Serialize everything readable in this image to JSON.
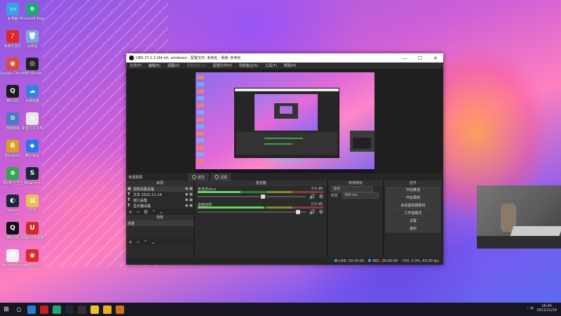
{
  "desktop": {
    "icons": [
      {
        "label": "此电脑",
        "color": "#3aa0e8",
        "glyph": "▭"
      },
      {
        "label": "Microsoft Edge",
        "color": "#1fa67a",
        "glyph": "e"
      },
      {
        "label": "网易云音乐",
        "color": "#e02828",
        "glyph": "♪"
      },
      {
        "label": "回收站",
        "color": "#7aa7d8",
        "glyph": "🗑"
      },
      {
        "label": "Google Chrome",
        "color": "#dd4b3e",
        "glyph": "◉"
      },
      {
        "label": "OBS Studio",
        "color": "#222222",
        "glyph": "◎"
      },
      {
        "label": "腾讯QQ",
        "color": "#1a1a1a",
        "glyph": "Q"
      },
      {
        "label": "百度网盘",
        "color": "#2f84e8",
        "glyph": "☁"
      },
      {
        "label": "控制面板",
        "color": "#4a7ac0",
        "glyph": "⚙"
      },
      {
        "label": "新建文本文档",
        "color": "#e8e8e8",
        "glyph": "≡"
      },
      {
        "label": "Bandizip",
        "color": "#d8a020",
        "glyph": "B"
      },
      {
        "label": "腾讯会议",
        "color": "#2878e8",
        "glyph": "◆"
      },
      {
        "label": "360安全卫士",
        "color": "#2ea84a",
        "glyph": "⊕"
      },
      {
        "label": "Steam++",
        "color": "#1b2838",
        "glyph": "S"
      },
      {
        "label": "Steam",
        "color": "#1b2838",
        "glyph": "◐"
      },
      {
        "label": "文件",
        "color": "#e8c050",
        "glyph": "▤"
      },
      {
        "label": "腾讯QQ",
        "color": "#111111",
        "glyph": "Q"
      },
      {
        "label": "网易UU加速器",
        "color": "#d02a2a",
        "glyph": "U"
      },
      {
        "label": "Wondershare",
        "color": "#f0f0f0",
        "glyph": "W"
      },
      {
        "label": "网易云音乐",
        "color": "#e02828",
        "glyph": "◉"
      }
    ]
  },
  "obs": {
    "title": "OBS 27.1.3 (64-bit, windows) - 配置文件: 未命名 - 场景: 未命名",
    "window_controls": {
      "minimize": "—",
      "maximize": "☐",
      "close": "✕"
    },
    "menu": [
      "文件(F)",
      "编辑(E)",
      "视图(V)",
      "停靠部件(D)",
      "配置文件(P)",
      "场景集合(S)",
      "工具(T)",
      "帮助(H)"
    ],
    "scene_bar": {
      "name": "未选择源",
      "properties": "属性",
      "filters": "滤镜"
    },
    "docks": {
      "sources_title": "来源",
      "scenes_title": "场景",
      "scenes_item": "场景",
      "mixer_title": "混音器",
      "transitions_title": "转场特效",
      "controls_title": "控件"
    },
    "sources": [
      {
        "type": "▣",
        "name": "视频采集设备"
      },
      {
        "type": "T",
        "name": "文本 2021-11-14"
      },
      {
        "type": "T",
        "name": "窗口采集"
      },
      {
        "type": "T",
        "name": "显示器采集"
      }
    ],
    "mixer": [
      {
        "name": "麦克风/Aux",
        "db": "-3.5 dB",
        "level": 0.62
      },
      {
        "name": "桌面音频",
        "db": "0.0 dB",
        "level": 0.95
      }
    ],
    "transition": {
      "type": "淡出",
      "duration_label": "时长",
      "duration": "300 ms"
    },
    "controls": [
      "开始推流",
      "开始录制",
      "启动虚拟摄像机",
      "工作室模式",
      "设置",
      "退出"
    ],
    "status": {
      "live": "LIVE: 00:00:00",
      "rec": "REC: 00:00:00",
      "cpu": "CPU: 0.9%, 60.00 fps"
    }
  },
  "taskbar": {
    "time": "16:40",
    "date": "2021/11/14",
    "tray_text": "⌃ 中",
    "apps": [
      {
        "name": "start",
        "color": "#ffffff"
      },
      {
        "name": "search",
        "color": "#ffffff"
      },
      {
        "name": "store",
        "color": "#2a7ad8"
      },
      {
        "name": "netease",
        "color": "#c02020"
      },
      {
        "name": "edge",
        "color": "#1fa67a"
      },
      {
        "name": "steam",
        "color": "#1b2838"
      },
      {
        "name": "obs",
        "color": "#333333"
      },
      {
        "name": "qq",
        "color": "#f0c030"
      },
      {
        "name": "file",
        "color": "#e8b020"
      },
      {
        "name": "app",
        "color": "#d07020"
      }
    ]
  }
}
